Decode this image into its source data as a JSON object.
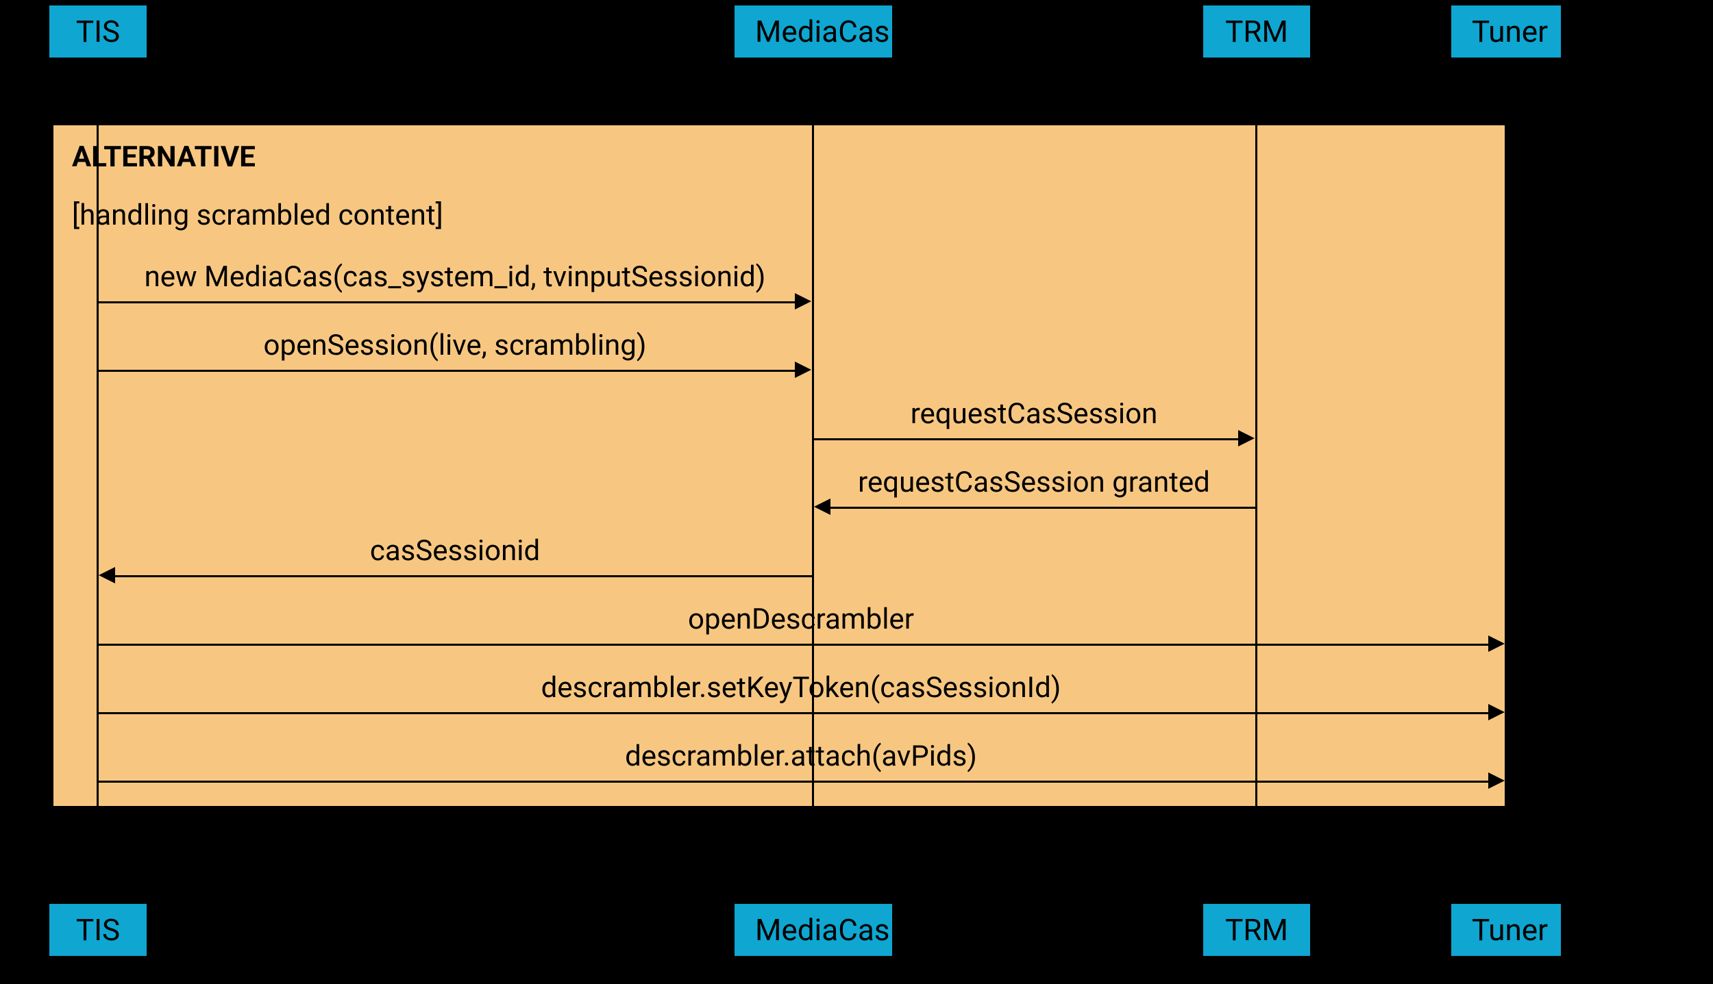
{
  "participants": {
    "tis": "TIS",
    "mediacas": "MediaCas",
    "trm": "TRM",
    "tuner": "Tuner"
  },
  "alt": {
    "title": "ALTERNATIVE",
    "guard": "[handling scrambled content]"
  },
  "messages": {
    "m1": "new MediaCas(cas_system_id, tvinputSessionid)",
    "m2": "openSession(live, scrambling)",
    "m3": "requestCasSession",
    "m4": "requestCasSession granted",
    "m5": "casSessionid",
    "m6": "openDescrambler",
    "m7": "descrambler.setKeyToken(casSessionId)",
    "m8": "descrambler.attach(avPids)"
  },
  "chart_data": {
    "type": "table",
    "diagram_kind": "sequence",
    "participants": [
      "TIS",
      "MediaCas",
      "TRM",
      "Tuner"
    ],
    "fragments": [
      {
        "type": "alt",
        "label": "ALTERNATIVE",
        "guards": [
          "handling scrambled content"
        ]
      }
    ],
    "messages": [
      {
        "from": "TIS",
        "to": "MediaCas",
        "label": "new MediaCas(cas_system_id, tvinputSessionid)",
        "return": false
      },
      {
        "from": "TIS",
        "to": "MediaCas",
        "label": "openSession(live, scrambling)",
        "return": false
      },
      {
        "from": "MediaCas",
        "to": "TRM",
        "label": "requestCasSession",
        "return": false
      },
      {
        "from": "TRM",
        "to": "MediaCas",
        "label": "requestCasSession granted",
        "return": true
      },
      {
        "from": "MediaCas",
        "to": "TIS",
        "label": "casSessionid",
        "return": true
      },
      {
        "from": "TIS",
        "to": "Tuner",
        "label": "openDescrambler",
        "return": false
      },
      {
        "from": "TIS",
        "to": "Tuner",
        "label": "descrambler.setKeyToken(casSessionId)",
        "return": false
      },
      {
        "from": "TIS",
        "to": "Tuner",
        "label": "descrambler.attach(avPids)",
        "return": false
      }
    ]
  }
}
